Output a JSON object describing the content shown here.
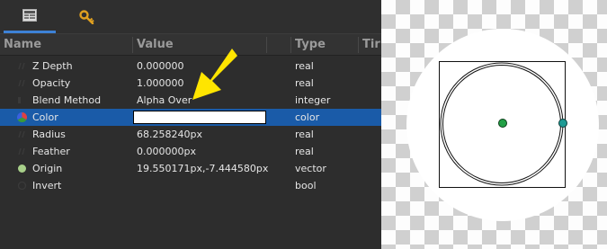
{
  "tabs": [
    {
      "icon": "params-panel-icon",
      "active": true
    },
    {
      "icon": "key-icon",
      "active": false
    }
  ],
  "columns": {
    "name": "Name",
    "value": "Value",
    "type": "Type",
    "time": "Tir"
  },
  "rows": [
    {
      "name": "Z Depth",
      "value": "0.000000",
      "type": "real"
    },
    {
      "name": "Opacity",
      "value": "1.000000",
      "type": "real"
    },
    {
      "name": "Blend Method",
      "value": "Alpha Over",
      "type": "integer"
    },
    {
      "name": "Color",
      "value": "",
      "type": "color",
      "selected": true,
      "color_value": "#ffffff"
    },
    {
      "name": "Radius",
      "value": "68.258240px",
      "type": "real"
    },
    {
      "name": "Feather",
      "value": "0.000000px",
      "type": "real"
    },
    {
      "name": "Origin",
      "value": "19.550171px,-7.444580px",
      "type": "vector"
    },
    {
      "name": "Invert",
      "value": "",
      "type": "bool"
    }
  ],
  "colors": {
    "selection": "#1a5ba8",
    "arrow": "#ffe500",
    "origin_handle": "#22a046",
    "radius_handle": "#1e9a94",
    "accent_tab": "#3d82d6"
  }
}
